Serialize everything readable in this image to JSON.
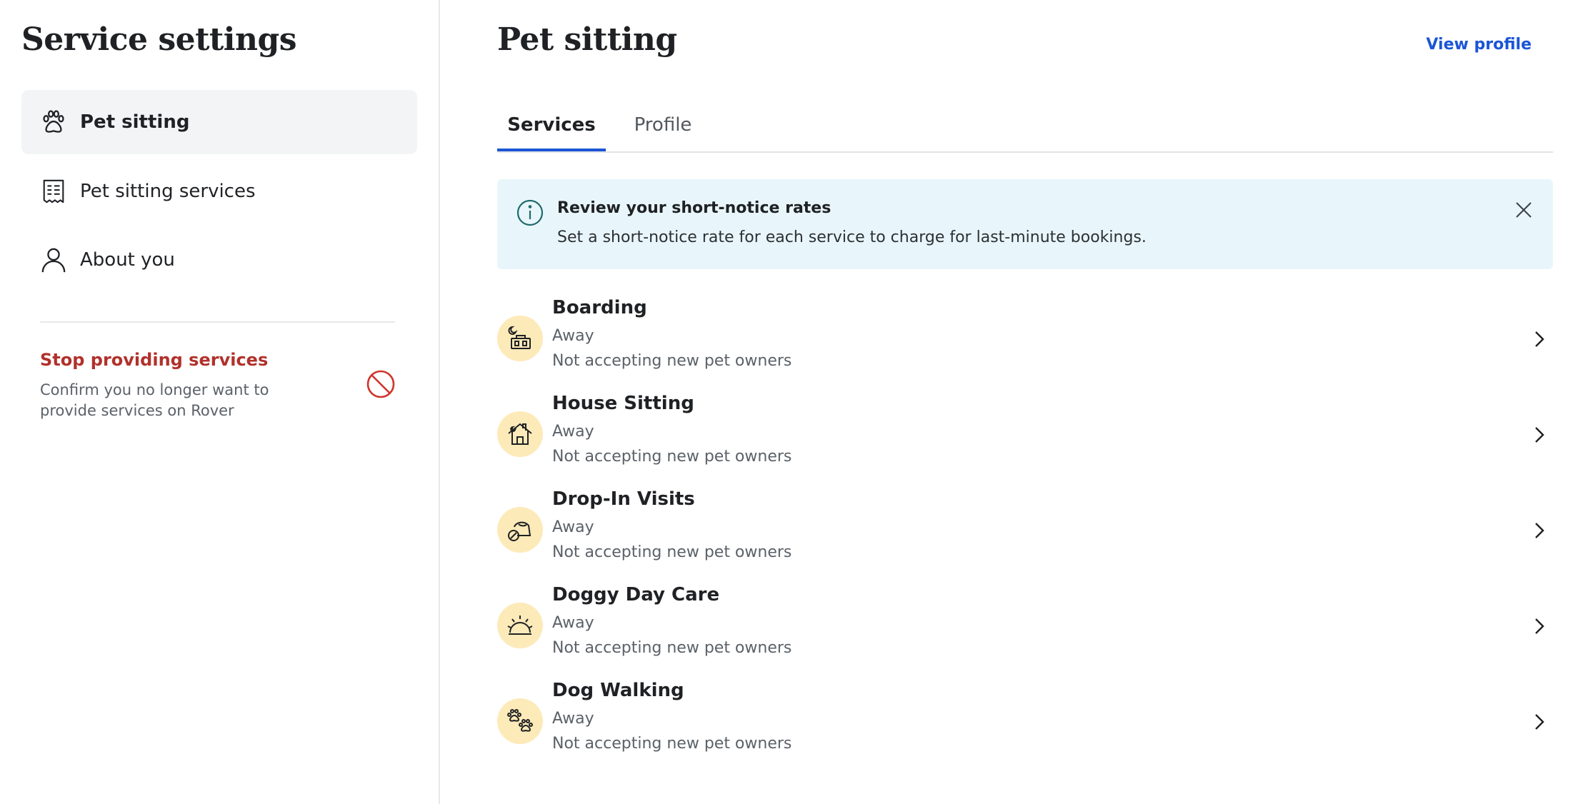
{
  "sidebar": {
    "title": "Service settings",
    "items": [
      {
        "label": "Pet sitting",
        "icon": "paw-icon"
      },
      {
        "label": "Pet sitting services",
        "icon": "receipt-icon"
      },
      {
        "label": "About you",
        "icon": "user-icon"
      }
    ],
    "stop": {
      "title": "Stop providing services",
      "description": "Confirm you no longer want to provide services on Rover",
      "icon": "prohibited-icon"
    }
  },
  "header": {
    "title": "Pet sitting",
    "view_profile": "View profile"
  },
  "tabs": [
    {
      "label": "Services",
      "active": true
    },
    {
      "label": "Profile",
      "active": false
    }
  ],
  "banner": {
    "title": "Review your short-notice rates",
    "text": "Set a short-notice rate for each service to charge for last-minute bookings."
  },
  "services": [
    {
      "name": "Boarding",
      "status": "Away",
      "note": "Not accepting new pet owners",
      "icon": "boarding-icon"
    },
    {
      "name": "House Sitting",
      "status": "Away",
      "note": "Not accepting new pet owners",
      "icon": "house-icon"
    },
    {
      "name": "Drop-In Visits",
      "status": "Away",
      "note": "Not accepting new pet owners",
      "icon": "food-bowl-icon"
    },
    {
      "name": "Doggy Day Care",
      "status": "Away",
      "note": "Not accepting new pet owners",
      "icon": "sun-icon"
    },
    {
      "name": "Dog Walking",
      "status": "Away",
      "note": "Not accepting new pet owners",
      "icon": "paws-icon"
    }
  ],
  "colors": {
    "accent": "#1b55d6",
    "danger": "#b1312b",
    "banner_bg": "#e8f6fb",
    "icon_bg": "#fdeab9"
  }
}
